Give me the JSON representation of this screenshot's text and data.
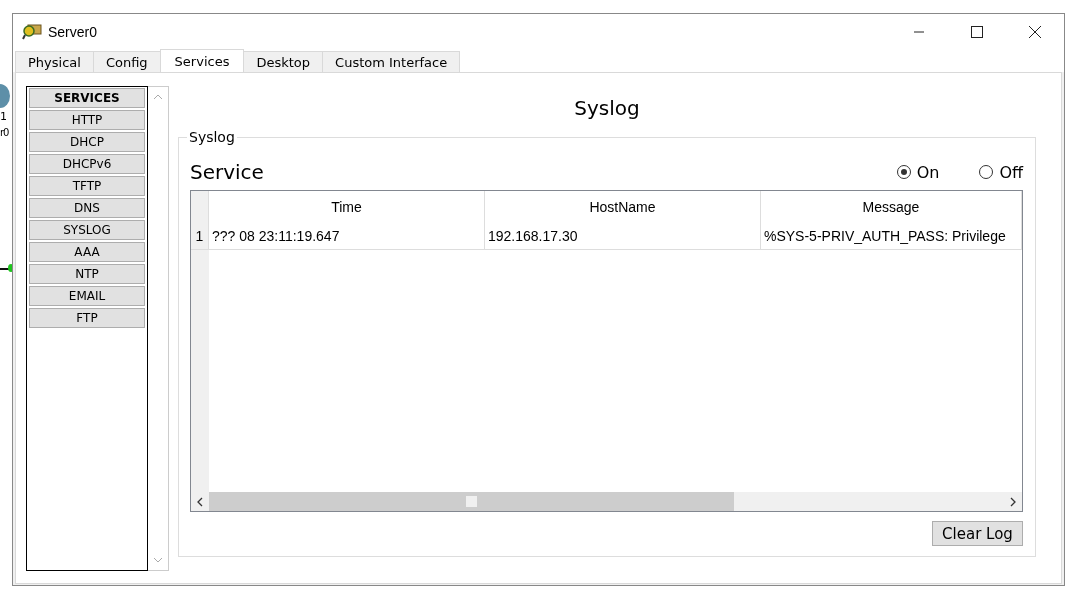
{
  "background_labels": [
    "1",
    "r0"
  ],
  "window": {
    "title": "Server0"
  },
  "tabs": [
    {
      "label": "Physical",
      "selected": false
    },
    {
      "label": "Config",
      "selected": false
    },
    {
      "label": "Services",
      "selected": true
    },
    {
      "label": "Desktop",
      "selected": false
    },
    {
      "label": "Custom Interface",
      "selected": false
    }
  ],
  "sidebar": {
    "items": [
      {
        "label": "SERVICES",
        "kind": "header"
      },
      {
        "label": "HTTP",
        "kind": "item"
      },
      {
        "label": "DHCP",
        "kind": "item"
      },
      {
        "label": "DHCPv6",
        "kind": "item"
      },
      {
        "label": "TFTP",
        "kind": "item"
      },
      {
        "label": "DNS",
        "kind": "item"
      },
      {
        "label": "SYSLOG",
        "kind": "item"
      },
      {
        "label": "AAA",
        "kind": "item"
      },
      {
        "label": "NTP",
        "kind": "item"
      },
      {
        "label": "EMAIL",
        "kind": "item"
      },
      {
        "label": "FTP",
        "kind": "item"
      }
    ]
  },
  "panel": {
    "title": "Syslog",
    "group_label": "Syslog",
    "service_label": "Service",
    "radios": [
      {
        "label": "On",
        "selected": true
      },
      {
        "label": "Off",
        "selected": false
      }
    ],
    "table": {
      "columns": [
        "Time",
        "HostName",
        "Message"
      ],
      "rows": [
        {
          "number": "1",
          "cells": [
            "??? 08 23:11:19.647",
            "192.168.17.30",
            "%SYS-5-PRIV_AUTH_PASS: Privilege"
          ]
        }
      ]
    },
    "buttons": [
      "Clear Log"
    ]
  }
}
